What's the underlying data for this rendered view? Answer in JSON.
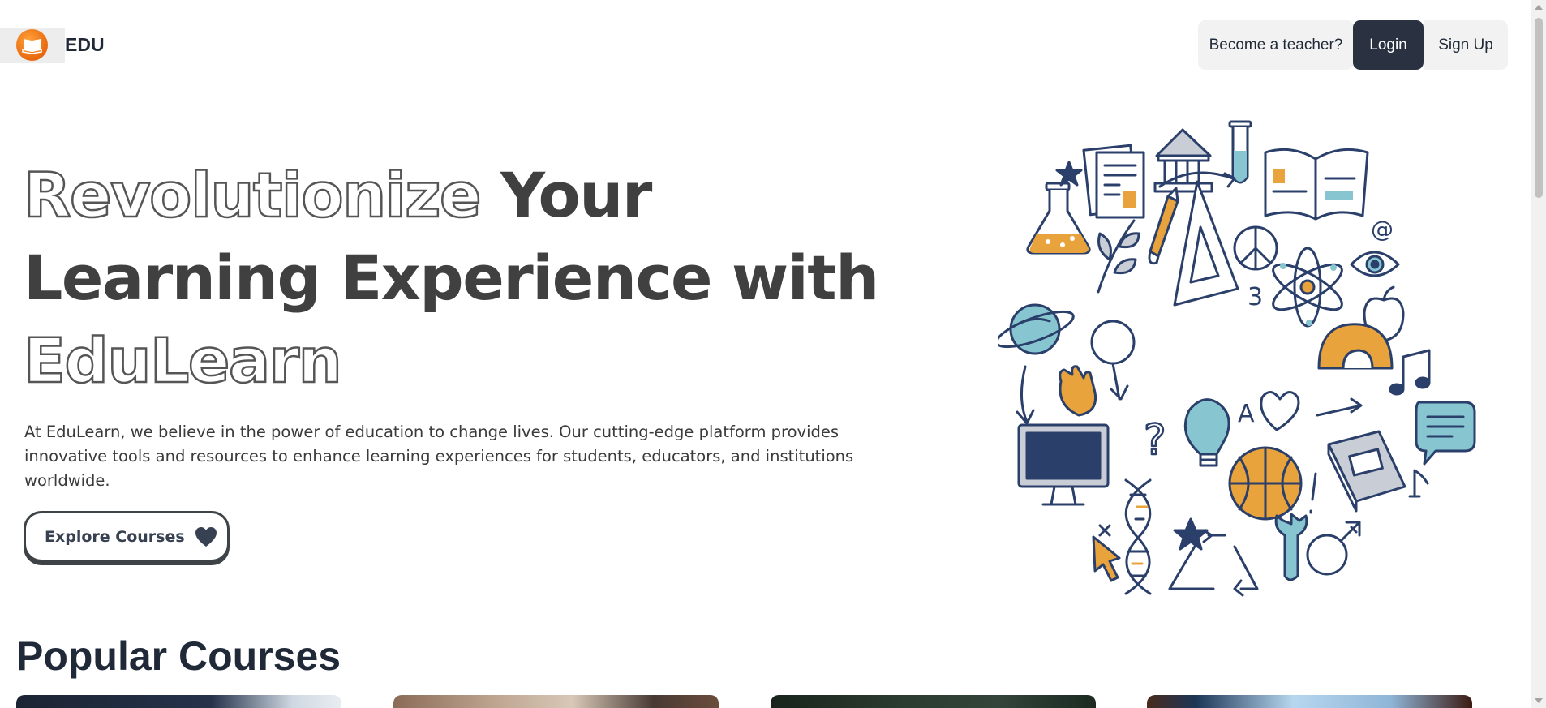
{
  "brand": {
    "logo_icon": "open-book-icon",
    "name": "EDU"
  },
  "nav": {
    "become_teacher": "Become a teacher?",
    "login": "Login",
    "signup": "Sign Up"
  },
  "hero": {
    "title_word_1": "Revolutionize",
    "title_word_2": "Your",
    "title_line_2": "Learning Experience with",
    "title_line_3": "EduLearn",
    "description": "At EduLearn, we believe in the power of education to change lives. Our cutting-edge platform provides innovative tools and resources to enhance learning experiences for students, educators, and institutions worldwide.",
    "cta_label": "Explore Courses",
    "cta_icon": "heart-icon",
    "illustration": "education-doodles-illustration"
  },
  "popular": {
    "title": "Popular Courses",
    "cards": [
      "course-card-1",
      "course-card-2",
      "course-card-3",
      "course-card-4"
    ]
  },
  "colors": {
    "accent_orange": "#e8a33c",
    "navy": "#2b3f6b",
    "teal": "#87c5d0",
    "login_bg": "#2a3140"
  }
}
